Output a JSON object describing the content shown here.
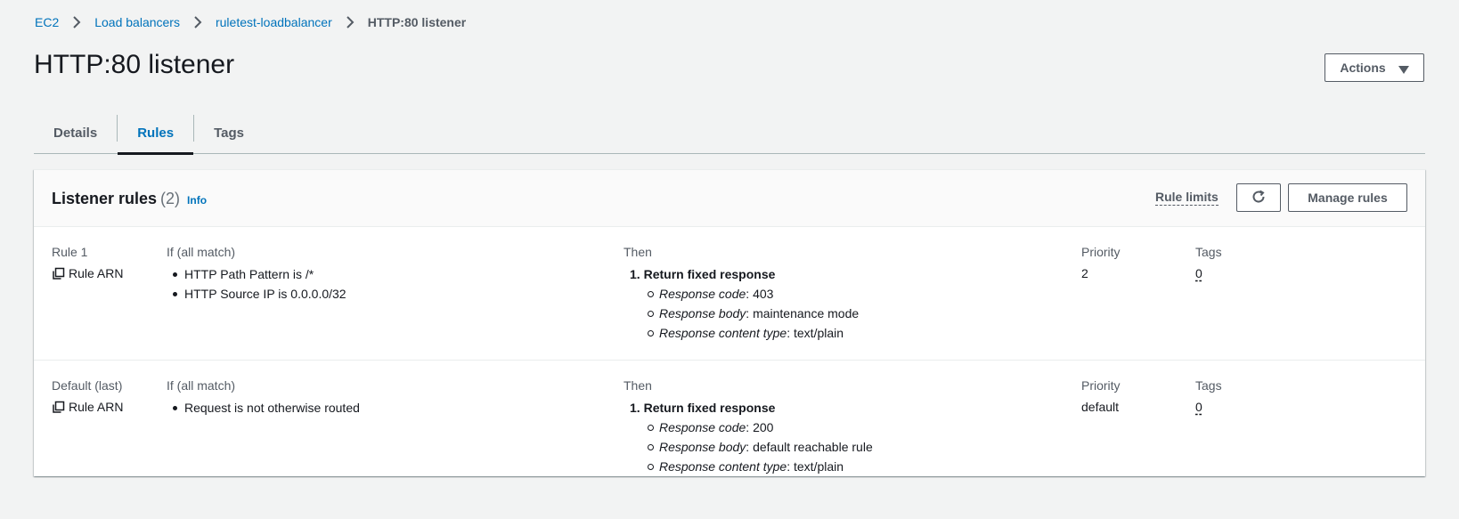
{
  "breadcrumb": {
    "items": [
      "EC2",
      "Load balancers",
      "ruletest-loadbalancer"
    ],
    "current": "HTTP:80 listener"
  },
  "page": {
    "title": "HTTP:80 listener",
    "actions_label": "Actions"
  },
  "tabs": [
    {
      "label": "Details",
      "active": false
    },
    {
      "label": "Rules",
      "active": true
    },
    {
      "label": "Tags",
      "active": false
    }
  ],
  "panel": {
    "title": "Listener rules",
    "count": "(2)",
    "info_label": "Info",
    "rule_limits_label": "Rule limits",
    "manage_rules_label": "Manage rules"
  },
  "rules": [
    {
      "name": "Rule 1",
      "arn_label": "Rule ARN",
      "if_label": "If (all match)",
      "conditions": [
        "HTTP Path Pattern is /*",
        "HTTP Source IP is 0.0.0.0/32"
      ],
      "then_label": "Then",
      "action_number": "1.",
      "action_title": "Return fixed response",
      "details": [
        {
          "key": "Response code",
          "value": ": 403"
        },
        {
          "key": "Response body",
          "value": ": maintenance mode"
        },
        {
          "key": "Response content type",
          "value": ": text/plain"
        }
      ],
      "priority_label": "Priority",
      "priority": "2",
      "tags_label": "Tags",
      "tags": "0"
    },
    {
      "name": "Default (last)",
      "arn_label": "Rule ARN",
      "if_label": "If (all match)",
      "conditions": [
        "Request is not otherwise routed"
      ],
      "then_label": "Then",
      "action_number": "1.",
      "action_title": "Return fixed response",
      "details": [
        {
          "key": "Response code",
          "value": ": 200"
        },
        {
          "key": "Response body",
          "value": ": default reachable rule"
        },
        {
          "key": "Response content type",
          "value": ": text/plain"
        }
      ],
      "priority_label": "Priority",
      "priority": "default",
      "tags_label": "Tags",
      "tags": "0"
    }
  ],
  "icons": {
    "breadcrumb_separator": "chevron-right-icon",
    "actions_caret": "caret-down-icon",
    "refresh": "refresh-icon",
    "copy": "copy-icon"
  },
  "colors": {
    "link": "#0073bb",
    "text": "#16191f",
    "secondary": "#545b64",
    "background": "#f2f3f3"
  }
}
